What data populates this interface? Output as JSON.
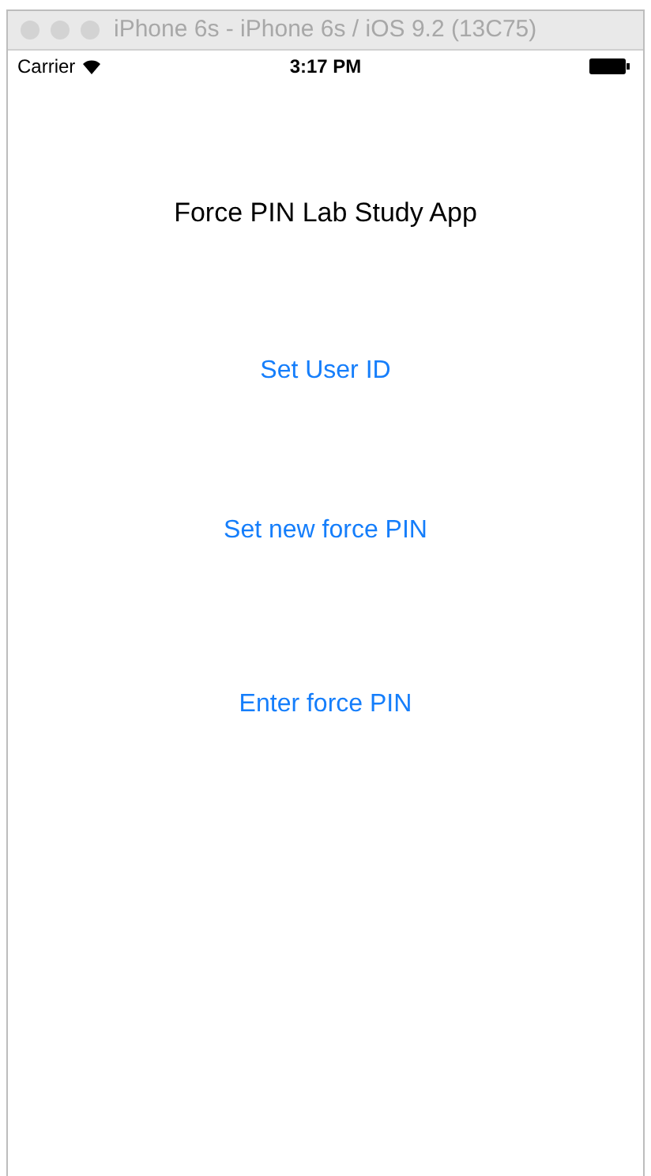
{
  "window": {
    "title": "iPhone 6s - iPhone 6s / iOS 9.2 (13C75)"
  },
  "status_bar": {
    "carrier": "Carrier",
    "time": "3:17 PM"
  },
  "screen": {
    "title": "Force PIN Lab Study App",
    "buttons": [
      "Set User ID",
      "Set new force PIN",
      "Enter force PIN"
    ]
  }
}
